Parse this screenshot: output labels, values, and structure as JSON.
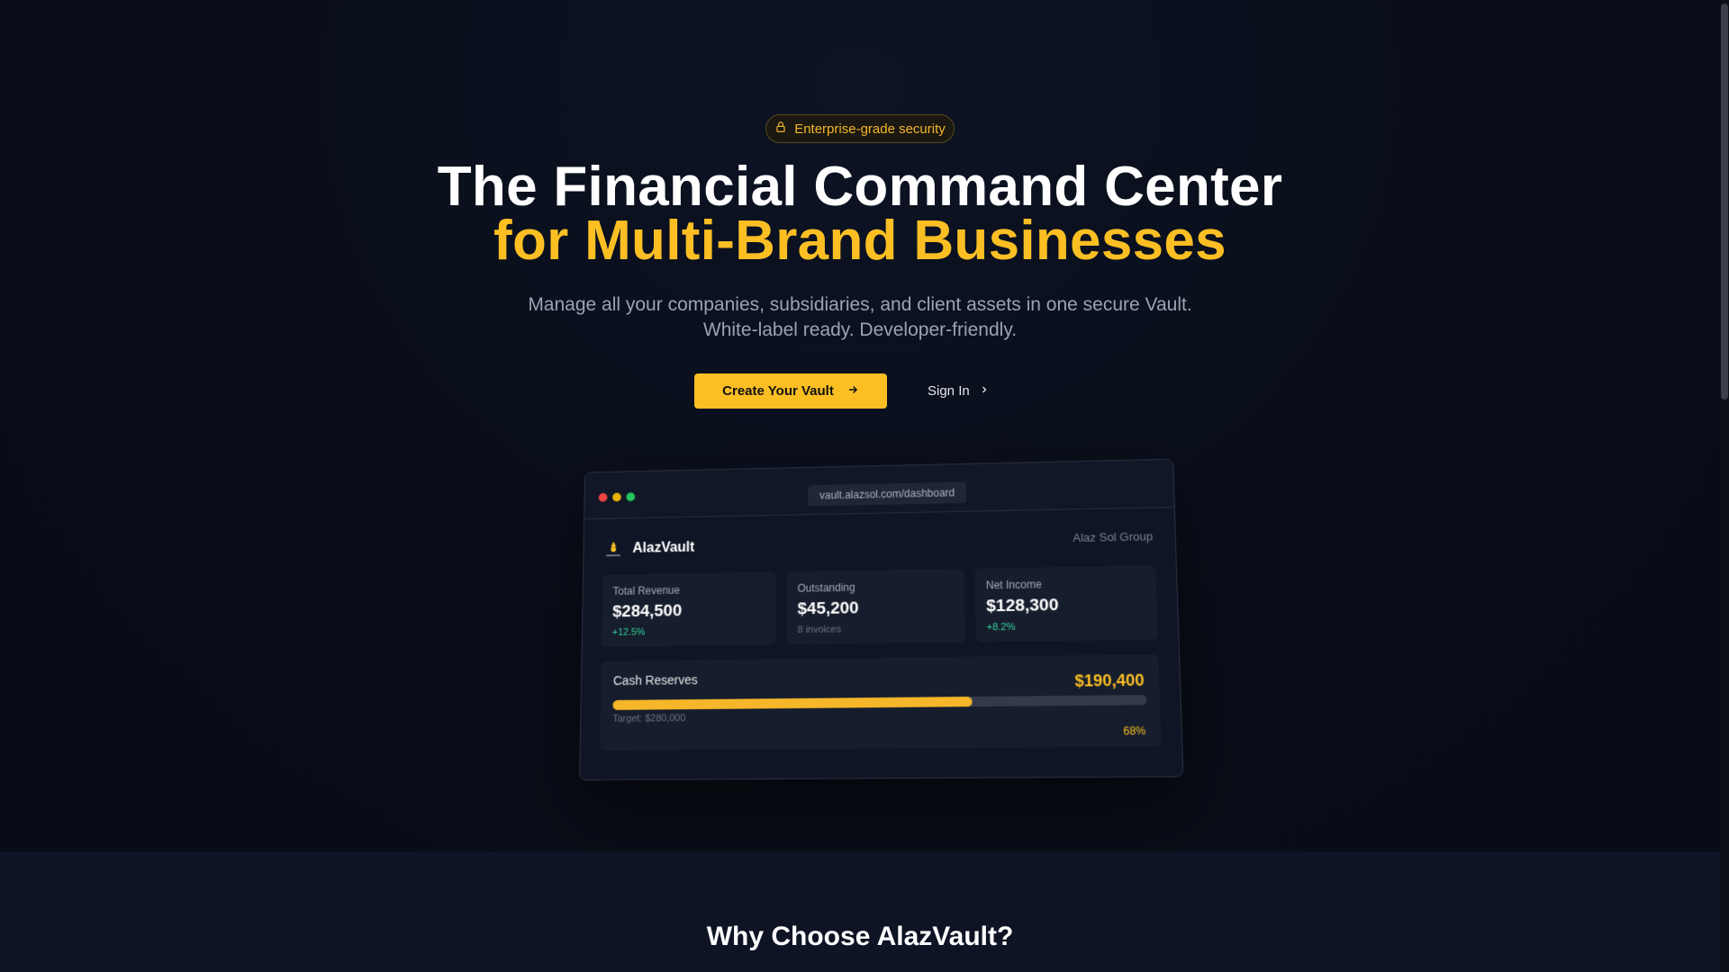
{
  "badge": {
    "text": "Enterprise-grade security",
    "icon": "lock-icon"
  },
  "headline": {
    "line1": "The Financial Command Center",
    "line2": "for Multi-Brand Businesses"
  },
  "subtitle": "Manage all your companies, subsidiaries, and client assets in one secure Vault. White-label ready. Developer-friendly.",
  "actions": {
    "primary_label": "Create Your Vault",
    "secondary_label": "Sign In"
  },
  "mockup": {
    "url": "vault.alazsol.com/dashboard",
    "brand": "AlazVault",
    "group": "Alaz Sol Group",
    "cards": [
      {
        "label": "Total Revenue",
        "value": "$284,500",
        "sub": "+12.5%"
      },
      {
        "label": "Outstanding",
        "value": "$45,200",
        "sub": "8 invoices"
      },
      {
        "label": "Net Income",
        "value": "$128,300",
        "sub": "+8.2%"
      }
    ],
    "reserves": {
      "label": "Cash Reserves",
      "value": "$190,400",
      "target": "Target: $280,000",
      "percent_label": "68%",
      "progress": 0.68
    }
  },
  "section2": {
    "title": "Why Choose AlazVault?"
  },
  "colors": {
    "accent": "#fbbf24",
    "background": "#0a0e1a",
    "positive": "#34d399"
  }
}
